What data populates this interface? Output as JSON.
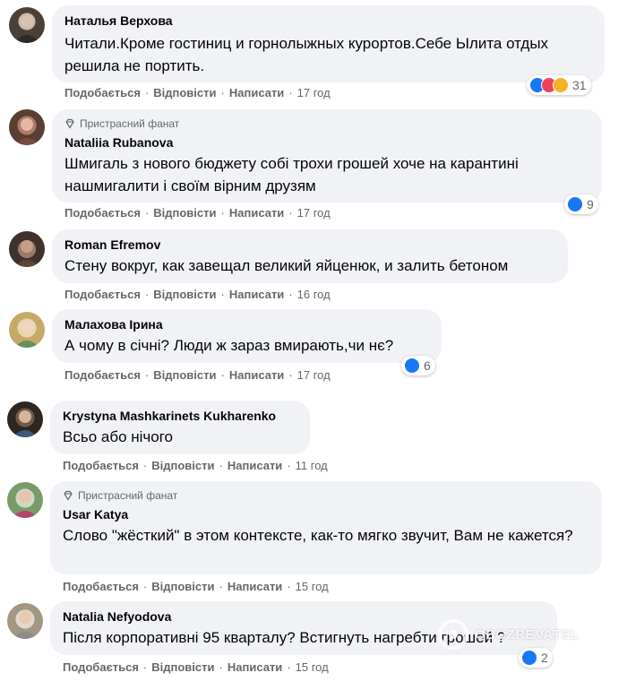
{
  "actions": {
    "like": "Подобається",
    "reply": "Відповісти",
    "write": "Написати",
    "sep": "·"
  },
  "badge_label": "Пристрасний фанат",
  "comments": [
    {
      "name": "Наталья Верхова",
      "text": "Читали.Кроме гостиниц и горнолыжных курортов.Себе Ылита отдых решила не портить.",
      "time": "17 год",
      "reactions": "31"
    },
    {
      "name": "Nataliia Rubanova",
      "text": "Шмигаль з нового бюджету собі трохи грошей хоче на карантині нашмигалити і своїм вірним друзям",
      "time": "17 год",
      "reactions": "9"
    },
    {
      "name": "Roman Efremov",
      "text": "Стену вокруг, как завещал великий яйценюк, и залить бетоном",
      "time": "16 год",
      "reactions": ""
    },
    {
      "name": "Малахова Ірина",
      "text": "А чому в січні? Люди ж зараз вмирають,чи нє?",
      "time": "17 год",
      "reactions": "6"
    },
    {
      "name": "Krystyna Mashkarinets Kukharenko",
      "text": "Всьо або нічого",
      "time": "11 год",
      "reactions": ""
    },
    {
      "name": "Usar Katya",
      "text": "Слово \"жёсткий\" в этом контексте, как-то мягко звучит, Вам не кажется?",
      "time": "15 год",
      "reactions": ""
    },
    {
      "name": "Natalia Nefyodova",
      "text": "Після корпоративні 95 кварталу? Встигнуть нагребти грошей ?",
      "time": "15 год",
      "reactions": "2"
    }
  ],
  "watermark": "OBOZREVATEL",
  "colors": {
    "like": "#1877f2",
    "love": "#f33e58",
    "haha": "#f7b125",
    "bubble": "#f0f2f5",
    "meta": "#65676b"
  }
}
